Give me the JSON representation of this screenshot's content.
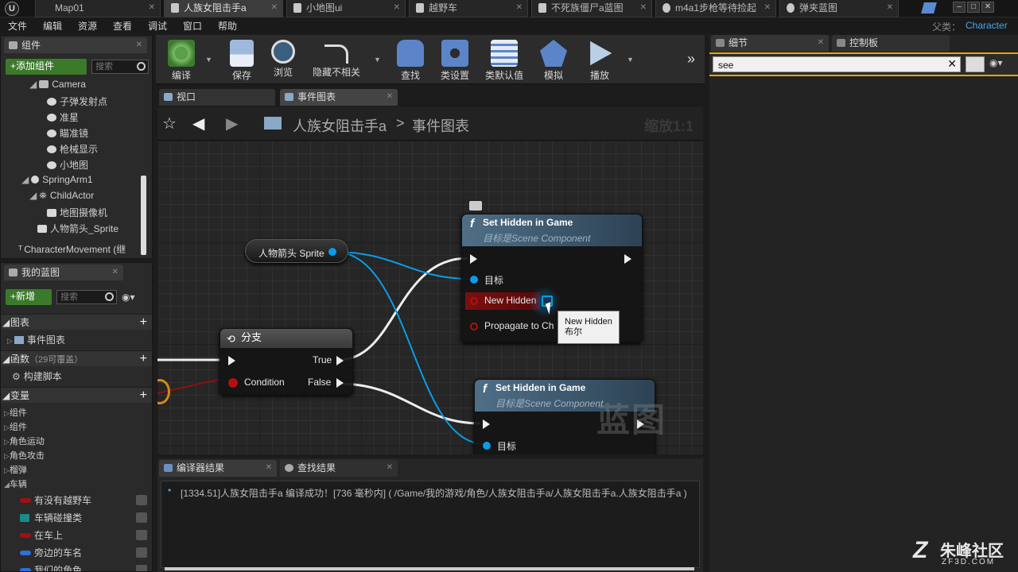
{
  "titlebar": {
    "tabs": [
      {
        "label": "Map01",
        "active": false
      },
      {
        "label": "人族女阻击手a",
        "active": true
      },
      {
        "label": "小地图ui",
        "active": false
      },
      {
        "label": "越野车",
        "active": false
      },
      {
        "label": "不死族僵尸a蓝图",
        "active": false
      },
      {
        "label": "m4a1步枪等待捡起",
        "active": false
      },
      {
        "label": "弹夹蓝图",
        "active": false
      }
    ]
  },
  "menubar": {
    "items": [
      "文件",
      "编辑",
      "资源",
      "查看",
      "调试",
      "窗口",
      "帮助"
    ],
    "parent_label": "父类：",
    "parent_value": "Character"
  },
  "components": {
    "tab_label": "组件",
    "add_label": "+添加组件",
    "search_placeholder": "搜索",
    "tree": [
      {
        "label": "Camera",
        "indent": 1
      },
      {
        "label": "子弹发射点",
        "indent": 2
      },
      {
        "label": "准星",
        "indent": 2
      },
      {
        "label": "瞄准镜",
        "indent": 2
      },
      {
        "label": "枪械显示",
        "indent": 2
      },
      {
        "label": "小地图",
        "indent": 2
      },
      {
        "label": "SpringArm1",
        "indent": 1
      },
      {
        "label": "ChildActor",
        "indent": 1
      },
      {
        "label": "地图摄像机",
        "indent": 2
      },
      {
        "label": "人物箭头_Sprite",
        "indent": 1
      },
      {
        "label": "CharacterMovement (继",
        "indent": 0
      }
    ]
  },
  "my_blueprint": {
    "tab_label": "我的蓝图",
    "new_label": "+新增",
    "search_placeholder": "搜索",
    "graphs_label": "图表",
    "event_graph_label": "事件图表",
    "functions_label": "函数",
    "functions_count": "（29可覆盖）",
    "construct_label": "构建脚本",
    "variables_label": "变量",
    "categories": [
      "组件",
      "组件",
      "角色运动",
      "角色攻击",
      "榴弹",
      "车辆"
    ],
    "vars": [
      {
        "label": "有没有越野车",
        "color": "#a01010"
      },
      {
        "label": "车辆碰撞类",
        "color": "#1b8a8a"
      },
      {
        "label": "在车上",
        "color": "#a01010"
      },
      {
        "label": "旁边的车名",
        "color": "#2e6fd8"
      },
      {
        "label": "我们的角色",
        "color": "#2e6fd8"
      }
    ]
  },
  "toolbar": {
    "buttons": [
      {
        "label": "编译",
        "icon": "compile-icon"
      },
      {
        "label": "保存",
        "icon": "save-icon"
      },
      {
        "label": "浏览",
        "icon": "browse-icon"
      },
      {
        "label": "隐藏不相关",
        "icon": "hide-unrelated-icon"
      },
      {
        "label": "查找",
        "icon": "find-icon"
      },
      {
        "label": "类设置",
        "icon": "class-settings-icon"
      },
      {
        "label": "类默认值",
        "icon": "class-defaults-icon"
      },
      {
        "label": "模拟",
        "icon": "simulate-icon"
      },
      {
        "label": "播放",
        "icon": "play-icon"
      }
    ]
  },
  "graph_tabs": {
    "viewport": "视口",
    "event_graph": "事件图表"
  },
  "graph": {
    "breadcrumb_root": "人族女阻击手a",
    "breadcrumb_sep": ">",
    "breadcrumb_leaf": "事件图表",
    "zoom": "缩放1:1",
    "watermark": "蓝图",
    "var_node_label": "人物箭头 Sprite",
    "branch": {
      "title": "分支",
      "condition": "Condition",
      "true_label": "True",
      "false_label": "False"
    },
    "node1": {
      "title": "Set Hidden in Game",
      "subtitle": "目标是Scene Component",
      "target": "目标",
      "new_hidden": "New Hidden",
      "propagate": "Propagate to Ch"
    },
    "node2": {
      "title": "Set Hidden in Game",
      "subtitle": "目标是Scene Component",
      "target": "目标"
    },
    "tooltip": {
      "line1": "New Hidden",
      "line2": "布尔"
    }
  },
  "bottom": {
    "tab_compiler": "编译器结果",
    "tab_find": "查找结果",
    "log": "[1334.51]人族女阻击手a 编译成功！[736 毫秒内] ( /Game/我的游戏/角色/人族女阻击手a/人族女阻击手a.人族女阻击手a )"
  },
  "right": {
    "tab_details": "细节",
    "tab_palette": "控制板",
    "search_value": "see"
  },
  "brand": {
    "name": "朱峰社区",
    "url": "ZF3D.COM"
  }
}
